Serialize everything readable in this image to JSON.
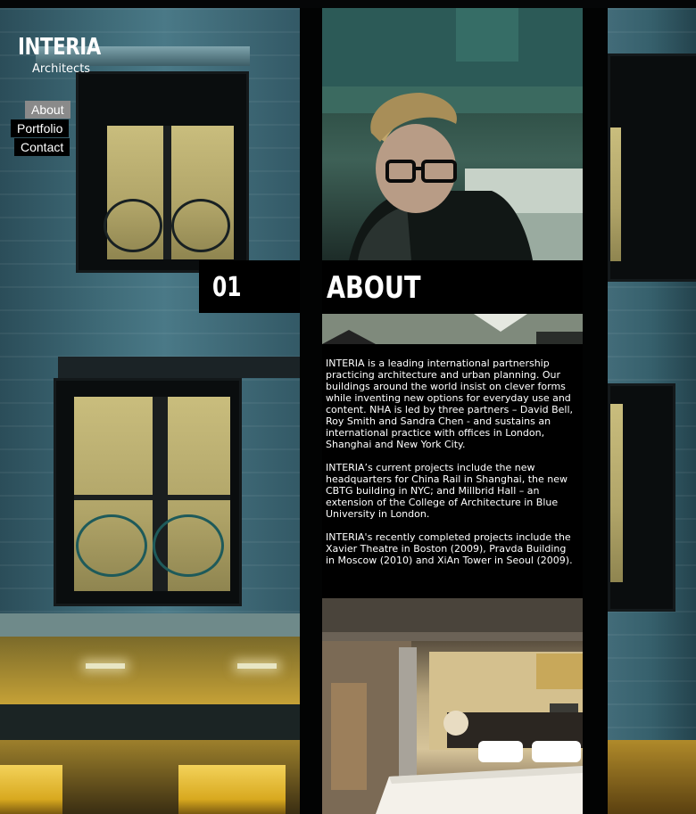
{
  "brand": {
    "title": "INTERIA",
    "subtitle": "Architects"
  },
  "nav": {
    "items": [
      {
        "label": "About",
        "active": true
      },
      {
        "label": "Portfolio",
        "active": false
      },
      {
        "label": "Contact",
        "active": false
      }
    ]
  },
  "section": {
    "number": "01",
    "title": "ABOUT"
  },
  "content": {
    "paragraphs": [
      "INTERIA is a leading international partnership practicing architecture and urban planning. Our buildings around the world insist on clever forms while inventing new options for everyday use and content. NHA is led by three partners – David Bell, Roy Smith and Sandra Chen - and sustains an international practice with offices in London, Shanghai and New York City.",
      "INTERIA’s current projects include the new headquarters for China Rail in Shanghai, the new CBTG building in NYC; and Millbrid Hall – an extension of the College of Architecture in Blue University in London.",
      "INTERIA's recently completed projects include the Xavier Theatre in Boston (2009), Pravda Building in Moscow (2010) and XiAn Tower in Seoul (2009)."
    ]
  },
  "colors": {
    "nav_active_bg": "#8a8a8a",
    "panel_bg": "#000000",
    "text": "#ffffff"
  }
}
